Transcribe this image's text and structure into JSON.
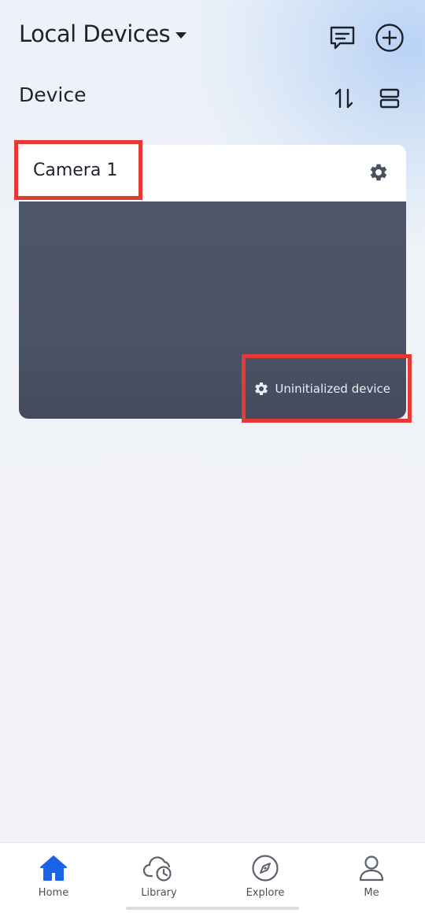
{
  "header": {
    "title": "Local Devices",
    "section_title": "Device"
  },
  "device_card": {
    "name": "Camera 1",
    "status_text": "Uninitialized device"
  },
  "tabbar": {
    "tabs": [
      {
        "label": "Home",
        "icon": "home-icon",
        "active": true
      },
      {
        "label": "Library",
        "icon": "cloud-clock-icon",
        "active": false
      },
      {
        "label": "Explore",
        "icon": "compass-icon",
        "active": false
      },
      {
        "label": "Me",
        "icon": "user-icon",
        "active": false
      }
    ]
  },
  "colors": {
    "accent": "#1a63e6",
    "highlight": "#e53935",
    "card_preview": "#4b5467"
  }
}
